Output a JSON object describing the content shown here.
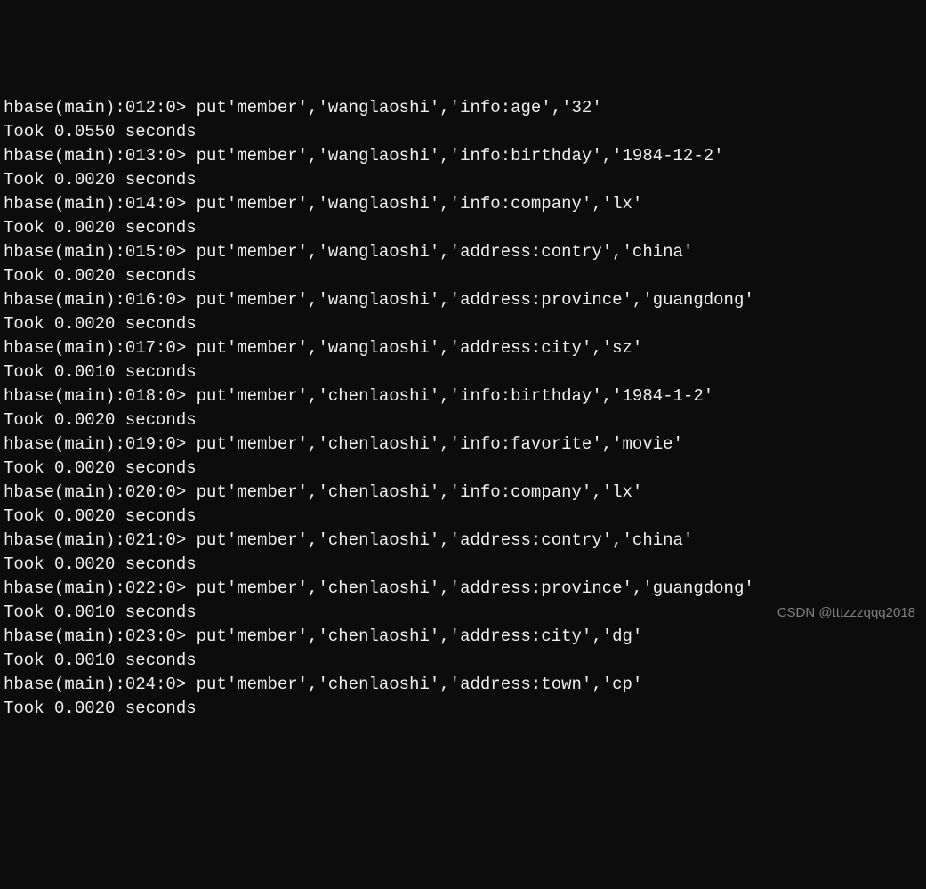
{
  "lines": [
    {
      "prompt": "hbase(main):012:0> ",
      "cmd": "put'member','wanglaoshi','info:age','32'"
    },
    {
      "output": "Took 0.0550 seconds"
    },
    {
      "prompt": "hbase(main):013:0> ",
      "cmd": "put'member','wanglaoshi','info:birthday','1984-12-2'"
    },
    {
      "output": "Took 0.0020 seconds"
    },
    {
      "prompt": "hbase(main):014:0> ",
      "cmd": "put'member','wanglaoshi','info:company','lx'"
    },
    {
      "output": "Took 0.0020 seconds"
    },
    {
      "prompt": "hbase(main):015:0> ",
      "cmd": "put'member','wanglaoshi','address:contry','china'"
    },
    {
      "output": "Took 0.0020 seconds"
    },
    {
      "prompt": "hbase(main):016:0> ",
      "cmd": "put'member','wanglaoshi','address:province','guangdong'"
    },
    {
      "output": "Took 0.0020 seconds"
    },
    {
      "prompt": "hbase(main):017:0> ",
      "cmd": "put'member','wanglaoshi','address:city','sz'"
    },
    {
      "output": "Took 0.0010 seconds"
    },
    {
      "prompt": "hbase(main):018:0> ",
      "cmd": "put'member','chenlaoshi','info:birthday','1984-1-2'"
    },
    {
      "output": "Took 0.0020 seconds"
    },
    {
      "prompt": "hbase(main):019:0> ",
      "cmd": "put'member','chenlaoshi','info:favorite','movie'"
    },
    {
      "output": "Took 0.0020 seconds"
    },
    {
      "prompt": "hbase(main):020:0> ",
      "cmd": "put'member','chenlaoshi','info:company','lx'"
    },
    {
      "output": "Took 0.0020 seconds"
    },
    {
      "prompt": "hbase(main):021:0> ",
      "cmd": "put'member','chenlaoshi','address:contry','china'"
    },
    {
      "output": "Took 0.0020 seconds"
    },
    {
      "prompt": "hbase(main):022:0> ",
      "cmd": "put'member','chenlaoshi','address:province','guangdong'"
    },
    {
      "output": "Took 0.0010 seconds"
    },
    {
      "prompt": "hbase(main):023:0> ",
      "cmd": "put'member','chenlaoshi','address:city','dg'"
    },
    {
      "output": "Took 0.0010 seconds"
    },
    {
      "prompt": "hbase(main):024:0> ",
      "cmd": "put'member','chenlaoshi','address:town','cp'"
    },
    {
      "output": "Took 0.0020 seconds"
    }
  ],
  "watermark": "CSDN @tttzzzqqq2018"
}
